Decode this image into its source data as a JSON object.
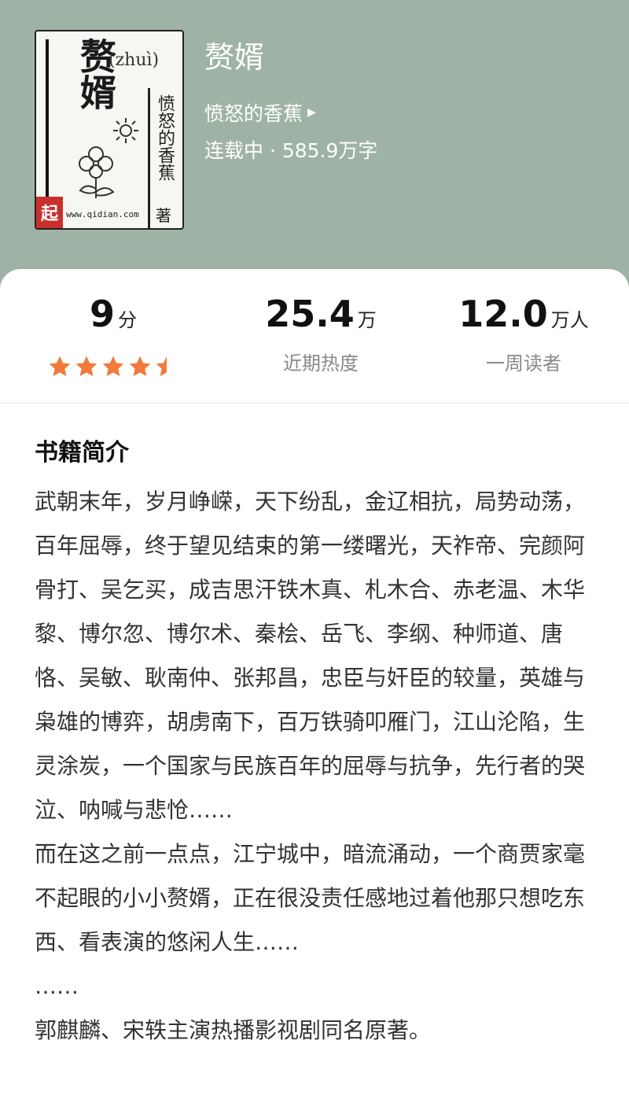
{
  "cover": {
    "title": "赘婿",
    "pinyin": "(zhuì)",
    "author_vertical": "愤怒的香蕉",
    "author_suffix": "著",
    "site": "www.qidian.com",
    "logo": "起"
  },
  "book": {
    "title": "赘婿",
    "author": "愤怒的香蕉",
    "author_caret_icon": "caret-right-icon",
    "status": "连载中 · 585.9万字"
  },
  "stats": [
    {
      "value": "9",
      "unit": "分",
      "label": ""
    },
    {
      "value": "25.4",
      "unit": "万",
      "label": "近期热度"
    },
    {
      "value": "12.0",
      "unit": "万人",
      "label": "一周读者"
    }
  ],
  "rating": {
    "stars": 4.5,
    "max": 5,
    "color": "#f27a3a"
  },
  "intro": {
    "title": "书籍简介",
    "paragraphs": [
      "武朝末年，岁月峥嵘，天下纷乱，金辽相抗，局势动荡，百年屈辱，终于望见结束的第一缕曙光，天祚帝、完颜阿骨打、吴乞买，成吉思汗铁木真、札木合、赤老温、木华黎、博尔忽、博尔术、秦桧、岳飞、李纲、种师道、唐恪、吴敏、耿南仲、张邦昌，忠臣与奸臣的较量，英雄与枭雄的博弈，胡虏南下，百万铁骑叩雁门，江山沦陷，生灵涂炭，一个国家与民族百年的屈辱与抗争，先行者的哭泣、呐喊与悲怆……",
      "而在这之前一点点，江宁城中，暗流涌动，一个商贾家毫不起眼的小小赘婿，正在很没责任感地过着他那只想吃东西、看表演的悠闲人生……",
      "……",
      "郭麒麟、宋轶主演热播影视剧同名原著。"
    ]
  },
  "colors": {
    "header_bg": "#9fb2a6",
    "star": "#f27a3a"
  }
}
